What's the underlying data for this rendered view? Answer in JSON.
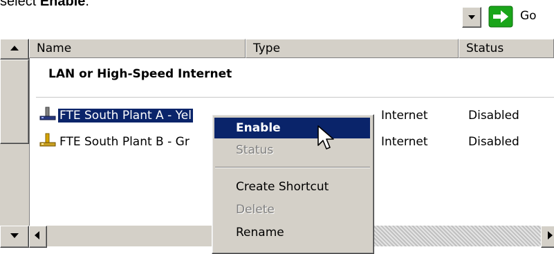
{
  "instruction": {
    "prefix": "select ",
    "bold": "Enable",
    "suffix": "."
  },
  "toolbar": {
    "go_label": "Go"
  },
  "columns": [
    {
      "label": "Name"
    },
    {
      "label": "Type"
    },
    {
      "label": "Status"
    }
  ],
  "group_header": "LAN or High-Speed Internet",
  "rows": [
    {
      "name": "FTE South Plant A - Yellow",
      "name_visible": "FTE South Plant A - Yel",
      "type_visible": "Internet",
      "status": "Disabled",
      "selected": true
    },
    {
      "name": "FTE South Plant B - Green",
      "name_visible": "FTE South Plant B - Gr",
      "type_visible": "Internet",
      "status": "Disabled",
      "selected": false
    }
  ],
  "context_menu": {
    "items": [
      {
        "label": "Enable",
        "state": "highlighted"
      },
      {
        "label": "Status",
        "state": "disabled"
      },
      {
        "label": "Create Shortcut",
        "state": "normal"
      },
      {
        "label": "Delete",
        "state": "disabled"
      },
      {
        "label": "Rename",
        "state": "normal"
      }
    ]
  },
  "colors": {
    "selection": "#0a246a",
    "face": "#d4d0c8",
    "go_arrow": "#1aa51a"
  },
  "icons": [
    "dropdown-arrow-icon",
    "go-arrow-icon",
    "network-connection-icon",
    "mouse-cursor-icon"
  ]
}
